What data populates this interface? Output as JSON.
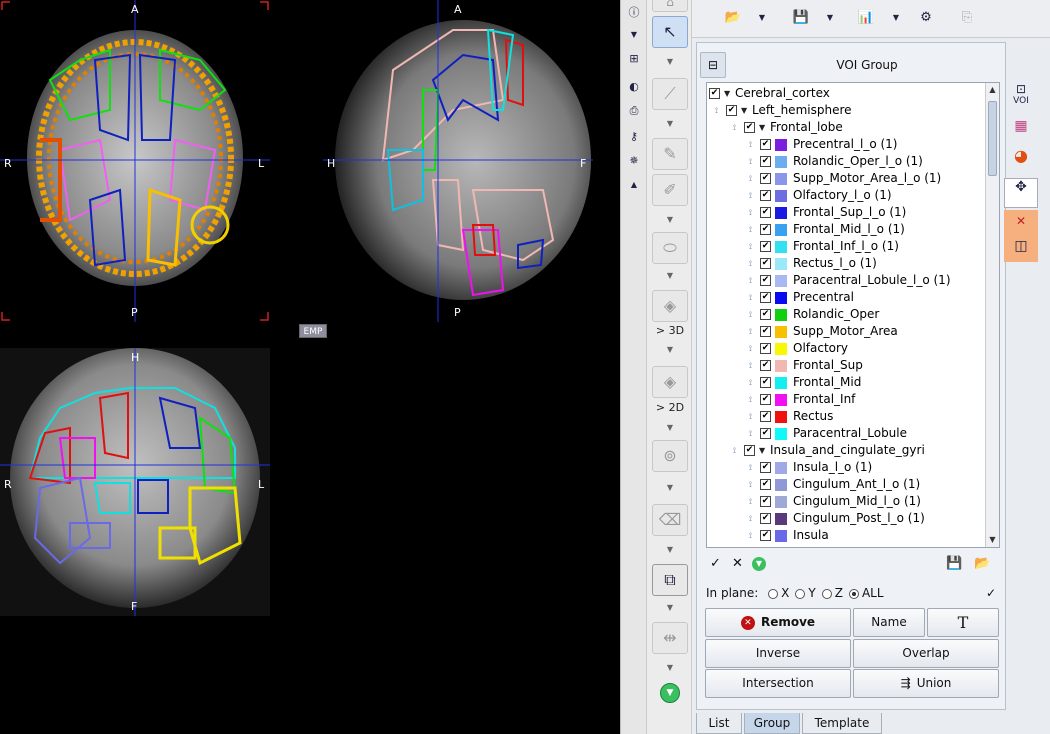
{
  "views": {
    "axial": {
      "top": "A",
      "bottom": "P",
      "left": "R",
      "right": "L"
    },
    "sagittal": {
      "top": "A",
      "bottom": "P",
      "left": "H",
      "right": "F"
    },
    "coronal": {
      "top": "H",
      "bottom": "F",
      "left": "R",
      "right": "L"
    },
    "emp_label": "EMP"
  },
  "toolbar_labels": {
    "to_3d": "> 3D",
    "to_2d": "> 2D"
  },
  "panel": {
    "title": "VOI Group",
    "tree": [
      {
        "level": 0,
        "label": "Cerebral_cortex",
        "group": true
      },
      {
        "level": 1,
        "label": "Left_hemisphere",
        "group": true
      },
      {
        "level": 2,
        "label": "Frontal_lobe",
        "group": true
      },
      {
        "level": 3,
        "label": "Precentral_l_o (1)",
        "color": "#7a1fe0"
      },
      {
        "level": 3,
        "label": "Rolandic_Oper_l_o (1)",
        "color": "#6aaef0"
      },
      {
        "level": 3,
        "label": "Supp_Motor_Area_l_o (1)",
        "color": "#8a96e8"
      },
      {
        "level": 3,
        "label": "Olfactory_l_o (1)",
        "color": "#6b6fe0"
      },
      {
        "level": 3,
        "label": "Frontal_Sup_l_o (1)",
        "color": "#1a1ae0"
      },
      {
        "level": 3,
        "label": "Frontal_Mid_l_o (1)",
        "color": "#3aa0f0"
      },
      {
        "level": 3,
        "label": "Frontal_Inf_l_o (1)",
        "color": "#32e0f0"
      },
      {
        "level": 3,
        "label": "Rectus_l_o (1)",
        "color": "#9ae8f8"
      },
      {
        "level": 3,
        "label": "Paracentral_Lobule_l_o (1)",
        "color": "#a8b8f0"
      },
      {
        "level": 3,
        "label": "Precentral",
        "color": "#0a0af0"
      },
      {
        "level": 3,
        "label": "Rolandic_Oper",
        "color": "#10d010"
      },
      {
        "level": 3,
        "label": "Supp_Motor_Area",
        "color": "#f8c000"
      },
      {
        "level": 3,
        "label": "Olfactory",
        "color": "#f8f800"
      },
      {
        "level": 3,
        "label": "Frontal_Sup",
        "color": "#f0b8b0"
      },
      {
        "level": 3,
        "label": "Frontal_Mid",
        "color": "#10f0f0"
      },
      {
        "level": 3,
        "label": "Frontal_Inf",
        "color": "#f010f0"
      },
      {
        "level": 3,
        "label": "Rectus",
        "color": "#f01010"
      },
      {
        "level": 3,
        "label": "Paracentral_Lobule",
        "color": "#10f8f8"
      },
      {
        "level": 2,
        "label": "Insula_and_cingulate_gyri",
        "group": true
      },
      {
        "level": 3,
        "label": "Insula_l_o (1)",
        "color": "#a0a8e8"
      },
      {
        "level": 3,
        "label": "Cingulum_Ant_l_o (1)",
        "color": "#9098d8"
      },
      {
        "level": 3,
        "label": "Cingulum_Mid_l_o (1)",
        "color": "#a0a8d8"
      },
      {
        "level": 3,
        "label": "Cingulum_Post_l_o (1)",
        "color": "#5a3a78"
      },
      {
        "level": 3,
        "label": "Insula",
        "color": "#6a6ae8"
      }
    ],
    "in_plane_label": "In plane:",
    "planes": [
      "X",
      "Y",
      "Z",
      "ALL"
    ],
    "selected_plane": "ALL",
    "buttons": {
      "remove": "Remove",
      "name": "Name",
      "text_icon": "T",
      "inverse": "Inverse",
      "overlap": "Overlap",
      "intersection": "Intersection",
      "union": "Union"
    },
    "tabs": [
      "List",
      "Group",
      "Template"
    ],
    "active_tab": "Group",
    "side_voi_label": "VOI"
  }
}
